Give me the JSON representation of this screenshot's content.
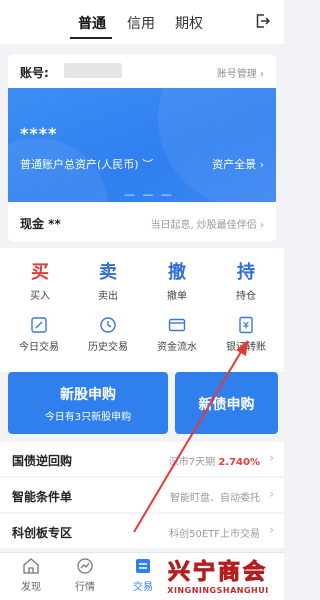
{
  "top_tabs": [
    "普通",
    "信用",
    "期权"
  ],
  "account": {
    "label": "账号:",
    "manage": "账号管理",
    "asset_value": "****",
    "asset_label": "普通账户总资产(人民币)",
    "eye_toggle": "︶",
    "overview": "资产全景",
    "pager_dots": "— — —",
    "cash_label": "现金 **",
    "slogan": "当日起息, 炒股最佳伴侣"
  },
  "quick_actions": [
    {
      "char": "买",
      "label": "买入",
      "color": "#e23b3b"
    },
    {
      "char": "卖",
      "label": "卖出",
      "color": "#2f6fd6"
    },
    {
      "char": "撤",
      "label": "撤单",
      "color": "#2f6fd6"
    },
    {
      "char": "持",
      "label": "持仓",
      "color": "#2f6fd6"
    }
  ],
  "functions": [
    {
      "label": "今日交易",
      "icon": "edit-doc-icon"
    },
    {
      "label": "历史交易",
      "icon": "clock-icon"
    },
    {
      "label": "资金流水",
      "icon": "card-icon"
    },
    {
      "label": "银证转账",
      "icon": "transfer-doc-icon"
    }
  ],
  "new_stock": {
    "title": "新股申购",
    "subtitle": "今日有3只新股申购"
  },
  "new_bond": {
    "title": "新债申购"
  },
  "list": [
    {
      "title": "国债逆回购",
      "right": "深市7天期",
      "rate": "2.740%"
    },
    {
      "title": "智能条件单",
      "right": "智能盯盘、自动委托"
    },
    {
      "title": "科创板专区",
      "right": "科创50ETF上市交易"
    }
  ],
  "bottom_nav": [
    {
      "label": "发现",
      "icon": "home-icon"
    },
    {
      "label": "行情",
      "icon": "chart-circle-icon"
    },
    {
      "label": "交易",
      "icon": "trade-icon"
    }
  ],
  "watermark": {
    "main": "兴宁商会",
    "sub": "XINGNINGSHANGHUI"
  },
  "colors": {
    "accent": "#2f80ed",
    "up": "#e23b3b",
    "annotation": "#e53935"
  }
}
